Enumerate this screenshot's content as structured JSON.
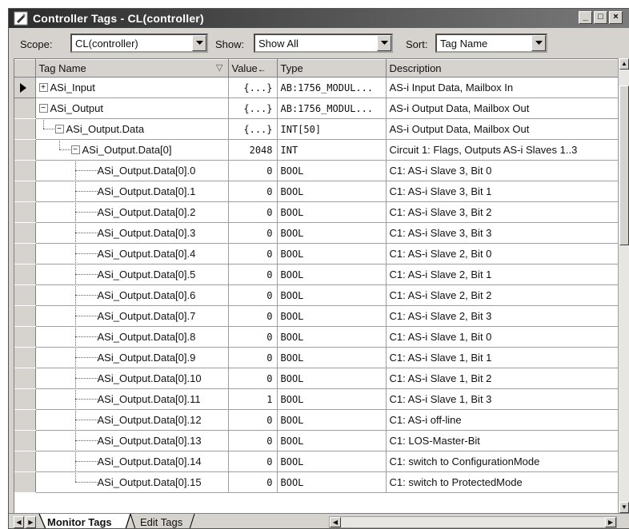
{
  "window": {
    "title": "Controller Tags - CL(controller)",
    "buttons": {
      "minimize": "_",
      "maximize": "□",
      "close": "×"
    }
  },
  "toolbar": {
    "scope_label": "Scope:",
    "scope_value": "CL(controller)",
    "show_label": "Show:",
    "show_value": "Show All",
    "sort_label": "Sort:",
    "sort_value": "Tag Name"
  },
  "table": {
    "headers": {
      "name": "Tag Name",
      "value": "Value",
      "type": "Type",
      "description": "Description"
    },
    "rows": [
      {
        "name": "ASi_Input",
        "value": "{...}",
        "type": "AB:1756_MODUL...",
        "description": "AS-i Input Data, Mailbox In"
      },
      {
        "name": "ASi_Output",
        "value": "{...}",
        "type": "AB:1756_MODUL...",
        "description": "AS-i Output Data, Mailbox Out"
      },
      {
        "name": "ASi_Output.Data",
        "value": "{...}",
        "type": "INT[50]",
        "description": "AS-i Output Data, Mailbox Out"
      },
      {
        "name": "ASi_Output.Data[0]",
        "value": "2048",
        "type": "INT",
        "description": "Circuit 1: Flags, Outputs AS-i Slaves 1..3"
      },
      {
        "name": "ASi_Output.Data[0].0",
        "value": "0",
        "type": "BOOL",
        "description": "C1: AS-i Slave 3, Bit 0"
      },
      {
        "name": "ASi_Output.Data[0].1",
        "value": "0",
        "type": "BOOL",
        "description": "C1: AS-i Slave 3, Bit 1"
      },
      {
        "name": "ASi_Output.Data[0].2",
        "value": "0",
        "type": "BOOL",
        "description": "C1: AS-i Slave 3, Bit 2"
      },
      {
        "name": "ASi_Output.Data[0].3",
        "value": "0",
        "type": "BOOL",
        "description": "C1: AS-i Slave 3, Bit 3"
      },
      {
        "name": "ASi_Output.Data[0].4",
        "value": "0",
        "type": "BOOL",
        "description": "C1: AS-i Slave 2, Bit 0"
      },
      {
        "name": "ASi_Output.Data[0].5",
        "value": "0",
        "type": "BOOL",
        "description": "C1: AS-i Slave 2, Bit 1"
      },
      {
        "name": "ASi_Output.Data[0].6",
        "value": "0",
        "type": "BOOL",
        "description": "C1: AS-i Slave 2, Bit 2"
      },
      {
        "name": "ASi_Output.Data[0].7",
        "value": "0",
        "type": "BOOL",
        "description": "C1: AS-i Slave 2, Bit 3"
      },
      {
        "name": "ASi_Output.Data[0].8",
        "value": "0",
        "type": "BOOL",
        "description": "C1: AS-i Slave 1, Bit 0"
      },
      {
        "name": "ASi_Output.Data[0].9",
        "value": "0",
        "type": "BOOL",
        "description": "C1: AS-i Slave 1, Bit 1"
      },
      {
        "name": "ASi_Output.Data[0].10",
        "value": "0",
        "type": "BOOL",
        "description": "C1: AS-i Slave 1, Bit 2"
      },
      {
        "name": "ASi_Output.Data[0].11",
        "value": "1",
        "type": "BOOL",
        "description": "C1: AS-i Slave 1, Bit 3"
      },
      {
        "name": "ASi_Output.Data[0].12",
        "value": "0",
        "type": "BOOL",
        "description": "C1: AS-i off-line"
      },
      {
        "name": "ASi_Output.Data[0].13",
        "value": "0",
        "type": "BOOL",
        "description": "C1: LOS-Master-Bit"
      },
      {
        "name": "ASi_Output.Data[0].14",
        "value": "0",
        "type": "BOOL",
        "description": "C1: switch to ConfigurationMode"
      },
      {
        "name": "ASi_Output.Data[0].15",
        "value": "0",
        "type": "BOOL",
        "description": "C1: switch to ProtectedMode"
      }
    ]
  },
  "tabs": [
    {
      "label": "Monitor Tags",
      "active": true
    },
    {
      "label": "Edit Tags",
      "active": false
    }
  ]
}
